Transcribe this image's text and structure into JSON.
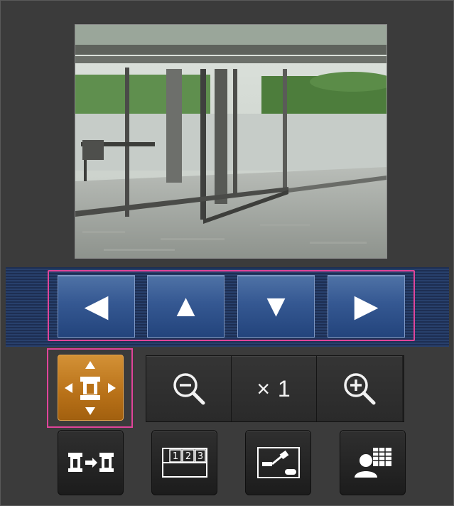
{
  "camera_view": {
    "icon": "live-camera-image"
  },
  "ptz": {
    "left_icon": "◀",
    "up_icon": "▲",
    "down_icon": "▼",
    "right_icon": "▶"
  },
  "control_mode": {
    "icon": "pan-tilt-mode-icon"
  },
  "zoom": {
    "zoom_out_icon": "zoom-out-icon",
    "level": "× 1",
    "zoom_in_icon": "zoom-in-icon"
  },
  "tools": {
    "camera_switch_icon": "camera-switch-icon",
    "preset_icon": "preset-positions-icon",
    "alarm_icon": "alarm-sensor-icon",
    "user_icon": "user-management-icon",
    "preset_numbers": [
      "1",
      "2",
      "3"
    ]
  },
  "colors": {
    "ptz_button": "#355892",
    "mode_button": "#b87118",
    "highlight": "#e0449a",
    "background": "#3b3b3b"
  }
}
